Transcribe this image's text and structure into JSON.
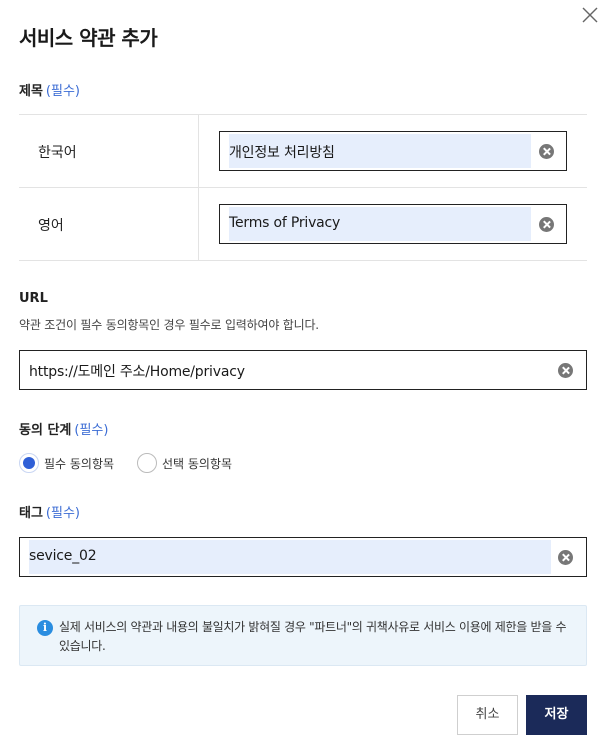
{
  "dialog": {
    "title": "서비스 약관 추가",
    "close_icon": "close-icon"
  },
  "title_section": {
    "label": "제목",
    "required": "(필수)",
    "rows": [
      {
        "lang": "한국어",
        "value": "개인정보 처리방침"
      },
      {
        "lang": "영어",
        "value": "Terms of Privacy"
      }
    ]
  },
  "url_section": {
    "label": "URL",
    "help": "약관 조건이 필수 동의항목인 경우 필수로 입력하여야 합니다.",
    "value": "https://도메인 주소/Home/privacy"
  },
  "consent_section": {
    "label": "동의 단계",
    "required": "(필수)",
    "options": [
      {
        "label": "필수 동의항목",
        "selected": true
      },
      {
        "label": "선택 동의항목",
        "selected": false
      }
    ]
  },
  "tag_section": {
    "label": "태그",
    "required": "(필수)",
    "value": "sevice_02"
  },
  "notice": {
    "icon": "info-icon",
    "text": "실제 서비스의 약관과 내용의 불일치가 밝혀질 경우 \"파트너\"의 귀책사유로 서비스 이용에 제한을 받을 수 있습니다."
  },
  "buttons": {
    "cancel": "취소",
    "save": "저장"
  },
  "colors": {
    "accent": "#2f5fd6",
    "primary_button": "#1b2a59",
    "highlight": "#e6eefc",
    "notice_bg": "#edf5fb",
    "info_icon": "#2a8de0"
  }
}
